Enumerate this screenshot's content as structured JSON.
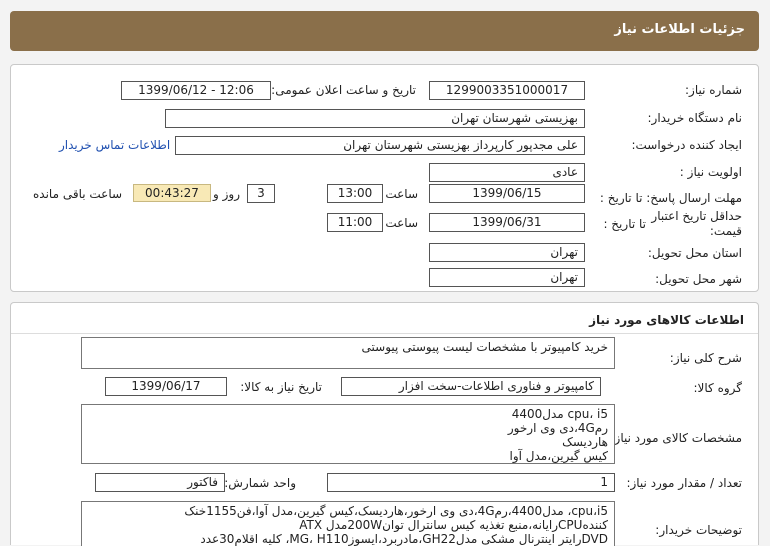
{
  "header": {
    "title": "جزئیات اطلاعات نیاز"
  },
  "info": {
    "need_number_label": "شماره نیاز:",
    "need_number": "1299003351000017",
    "announce_label": "تاریخ و ساعت اعلان عمومی:",
    "announce_value": "1399/06/12 - 12:06",
    "buyer_org_label": "نام دستگاه خریدار:",
    "buyer_org": "بهزیستی شهرستان تهران",
    "requester_label": "ایجاد کننده درخواست:",
    "requester": "علی  مجدپور کارپرداز  بهزیستی شهرستان تهران",
    "contact_link": "اطلاعات تماس خریدار",
    "priority_label": "اولویت نیاز :",
    "priority": "عادی",
    "deadline_label": "مهلت ارسال پاسخ:  تا تاریخ :",
    "deadline_date": "1399/06/15",
    "time_label": "ساعت",
    "deadline_time": "13:00",
    "days_value": "3",
    "days_label": "روز و",
    "remaining_time": "00:43:27",
    "remaining_label": "ساعت باقی مانده",
    "validity_label_1": "حداقل تاریخ اعتبار",
    "validity_label_2": "قیمت:",
    "validity_to_label": "تا تاریخ :",
    "validity_date": "1399/06/31",
    "validity_time": "11:00",
    "province_label": "استان محل تحویل:",
    "province": "تهران",
    "city_label": "شهر محل تحویل:",
    "city": "تهران"
  },
  "goods": {
    "section_title": "اطلاعات کالاهای مورد نیاز",
    "general_desc_label": "شرح کلی نیاز:",
    "general_desc": "خرید کامپیوتر با مشخصات لیست پیوستی پیوستی",
    "group_label": "گروه کالا:",
    "group_value": "کامپیوتر و فناوری اطلاعات-سخت افزار",
    "need_date_label": "تاریخ نیاز به کالا:",
    "need_date": "1399/06/17",
    "spec_label": "مشخصات کالای مورد نیاز:",
    "spec_lines": [
      "cpu، i5 مدل4400",
      "رم4G،دی وی ارخور",
      "هاردیسک",
      "کیس گیرین،مدل آوا"
    ],
    "qty_label": "تعداد / مقدار مورد نیاز:",
    "qty_value": "1",
    "unit_label": "واحد شمارش:",
    "unit_value": "فاکتور",
    "buyer_notes_label": "توضیحات خریدار:",
    "buyer_notes_lines": [
      "cpu،i5، مدل4400،رم4G،دی وی ارخور،هاردیسک،کیس گیرین،مدل آوا،فن1155خنک",
      "کنندهCPUرایانه،منبع تغذیه کیس سانترال توان200Wمدل ATX",
      "DVDرایتر اینترنال مشکی مدلGH22،مادربرد،ایسوزMG، H110، کلیه اقلام30عدد"
    ]
  }
}
